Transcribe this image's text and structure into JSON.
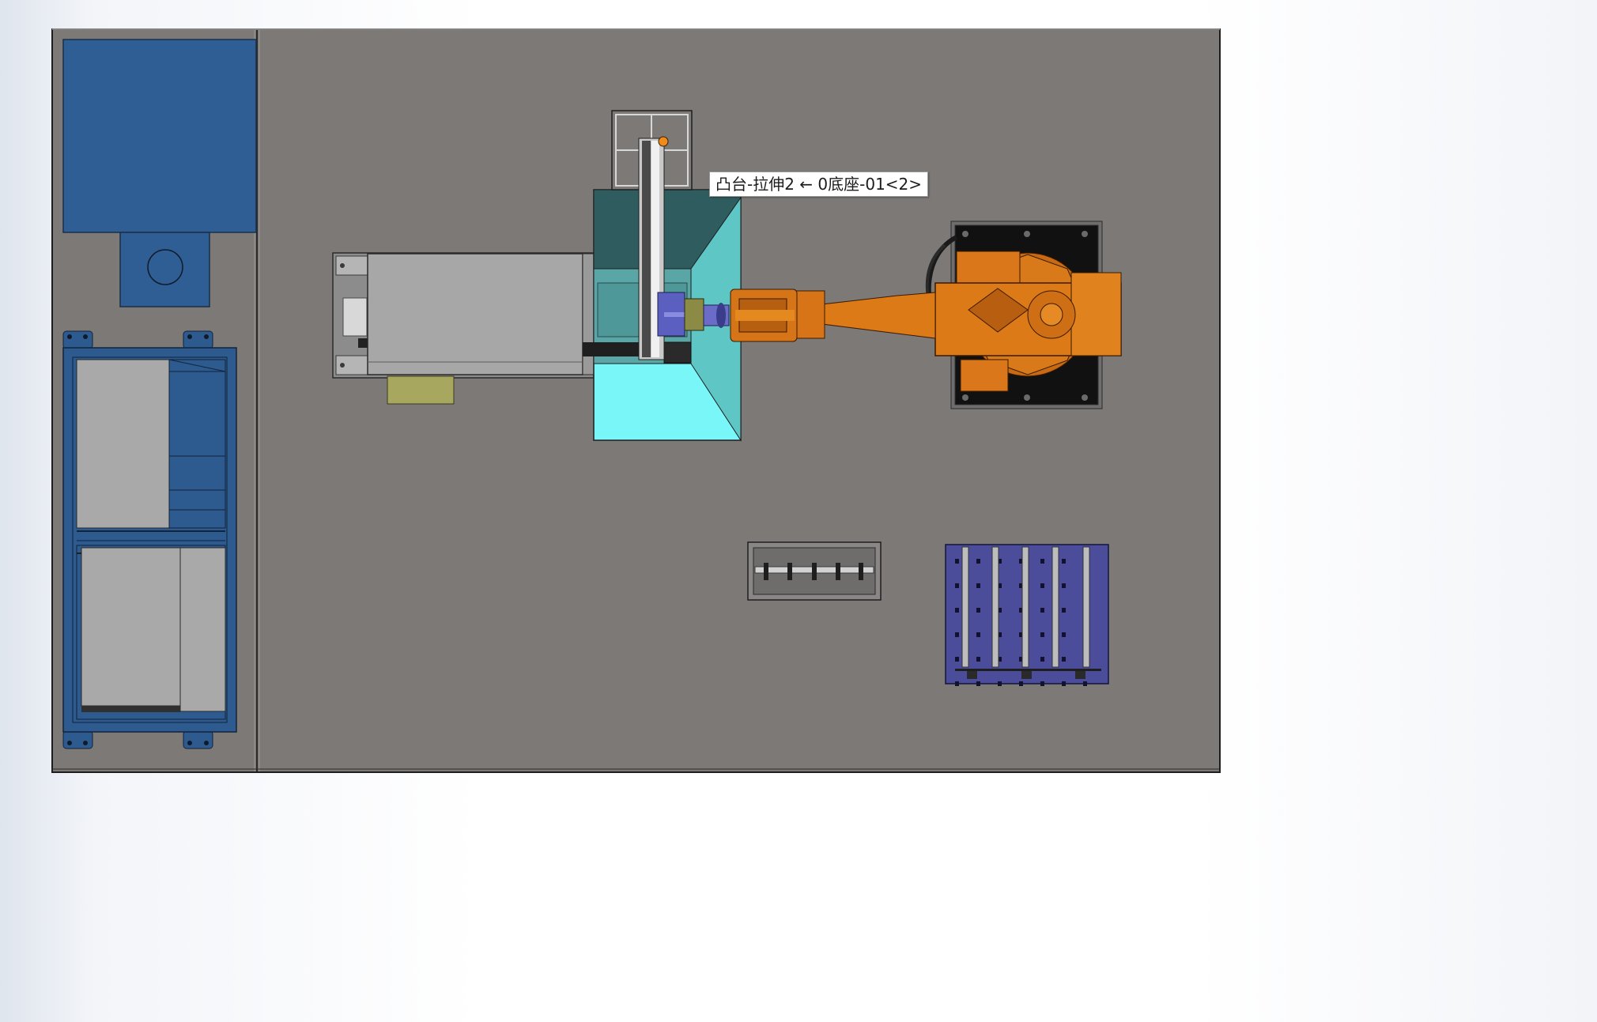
{
  "app": {
    "view": "CAD top view"
  },
  "selection_tooltip": {
    "text": "凸台-拉伸2 ← 0底座-01<2>"
  },
  "colors": {
    "background": "#ffffff",
    "floor": "#7d7977",
    "cabinet_blue": "#2e5e93",
    "rack_blue": "#2d5a8f",
    "enclosure_teal": "#2f5d5f",
    "enclosure_cyan": "#79f6f7",
    "robot_orange": "#dc7a18",
    "pallet_purple": "#4b4d9b",
    "machine_gray": "#a7a7a7",
    "olive_box": "#a8a75f"
  },
  "icons": {
    "tooltip_arrow": "left-arrow-icon"
  }
}
